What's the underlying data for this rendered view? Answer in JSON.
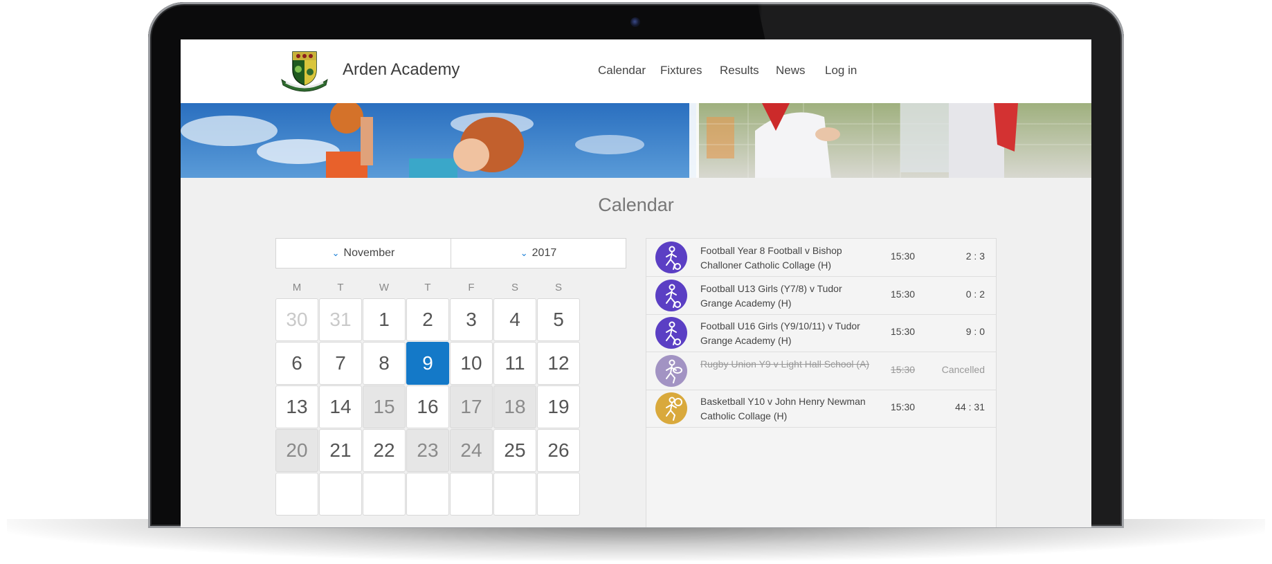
{
  "site": {
    "title": "Arden Academy"
  },
  "nav": [
    "Calendar",
    "Fixtures",
    "Results",
    "News",
    "Log in"
  ],
  "page_title": "Calendar",
  "selector": {
    "month": "November",
    "year": "2017"
  },
  "weekdays": [
    "M",
    "T",
    "W",
    "T",
    "F",
    "S",
    "S"
  ],
  "days": [
    {
      "label": "30",
      "state": "other"
    },
    {
      "label": "31",
      "state": "other"
    },
    {
      "label": "1",
      "state": ""
    },
    {
      "label": "2",
      "state": ""
    },
    {
      "label": "3",
      "state": ""
    },
    {
      "label": "4",
      "state": ""
    },
    {
      "label": "5",
      "state": ""
    },
    {
      "label": "6",
      "state": ""
    },
    {
      "label": "7",
      "state": ""
    },
    {
      "label": "8",
      "state": ""
    },
    {
      "label": "9",
      "state": "sel"
    },
    {
      "label": "10",
      "state": ""
    },
    {
      "label": "11",
      "state": ""
    },
    {
      "label": "12",
      "state": ""
    },
    {
      "label": "13",
      "state": ""
    },
    {
      "label": "14",
      "state": ""
    },
    {
      "label": "15",
      "state": "shade"
    },
    {
      "label": "16",
      "state": ""
    },
    {
      "label": "17",
      "state": "shade"
    },
    {
      "label": "18",
      "state": "shade"
    },
    {
      "label": "19",
      "state": ""
    },
    {
      "label": "20",
      "state": "shade"
    },
    {
      "label": "21",
      "state": ""
    },
    {
      "label": "22",
      "state": ""
    },
    {
      "label": "23",
      "state": "shade"
    },
    {
      "label": "24",
      "state": "shade"
    },
    {
      "label": "25",
      "state": ""
    },
    {
      "label": "26",
      "state": ""
    },
    {
      "label": "",
      "state": ""
    },
    {
      "label": "",
      "state": ""
    },
    {
      "label": "",
      "state": ""
    },
    {
      "label": "",
      "state": ""
    },
    {
      "label": "",
      "state": ""
    },
    {
      "label": "",
      "state": ""
    },
    {
      "label": "",
      "state": ""
    }
  ],
  "fixtures": [
    {
      "title": "Football Year 8 Football v Bishop Challoner Catholic Collage (H)",
      "time": "15:30",
      "score": "2 : 3",
      "icon": "football-icon",
      "color": "#5b3fc4",
      "cancelled": false
    },
    {
      "title": "Football U13 Girls (Y7/8) v Tudor Grange Academy (H)",
      "time": "15:30",
      "score": "0 : 2",
      "icon": "football-icon",
      "color": "#5b3fc4",
      "cancelled": false
    },
    {
      "title": "Football U16 Girls (Y9/10/11) v Tudor Grange Academy (H)",
      "time": "15:30",
      "score": "9 : 0",
      "icon": "football-icon",
      "color": "#5b3fc4",
      "cancelled": false
    },
    {
      "title": "Rugby Union Y9 v Light Hall School (A)",
      "time": "15:30",
      "score": "Cancelled",
      "icon": "rugby-icon",
      "color": "#a293c3",
      "cancelled": true
    },
    {
      "title": "Basketball Y10 v John Henry Newman Catholic Collage (H)",
      "time": "15:30",
      "score": "44 : 31",
      "icon": "basketball-icon",
      "color": "#d9a93c",
      "cancelled": false
    }
  ]
}
